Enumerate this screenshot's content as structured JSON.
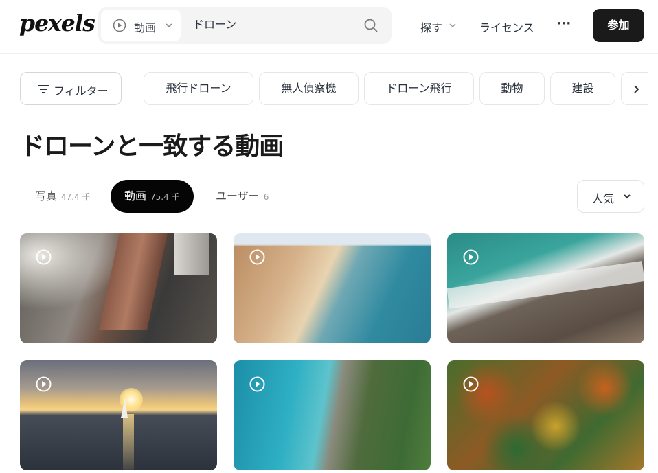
{
  "header": {
    "logo": "pexels",
    "search": {
      "media_type": "動画",
      "query": "ドローン"
    },
    "nav": {
      "explore": "探す",
      "license": "ライセンス",
      "more": "···",
      "join": "参加"
    }
  },
  "filters": {
    "filter_label": "フィルター",
    "chips": [
      "飛行ドローン",
      "無人偵察機",
      "ドローン飛行",
      "動物",
      "建設"
    ]
  },
  "page_title": "ドローンと一致する動画",
  "tabs": [
    {
      "label": "写真",
      "count": "47.4 千"
    },
    {
      "label": "動画",
      "count": "75.4 千",
      "active": true
    },
    {
      "label": "ユーザー",
      "count": "6"
    }
  ],
  "sort": {
    "label": "人気"
  },
  "videos": [
    {
      "subject": "city-skyscraper-aerial"
    },
    {
      "subject": "coastal-cliffs-beach-aerial"
    },
    {
      "subject": "waves-rocks-aerial"
    },
    {
      "subject": "sunset-sailboat-sea"
    },
    {
      "subject": "turquoise-coast-forest-aerial"
    },
    {
      "subject": "autumn-forest-aerial"
    }
  ],
  "colors": {
    "accent_dark": "#1a1a1a",
    "active_tab": "#050505",
    "search_bg": "#f4f4f4"
  }
}
